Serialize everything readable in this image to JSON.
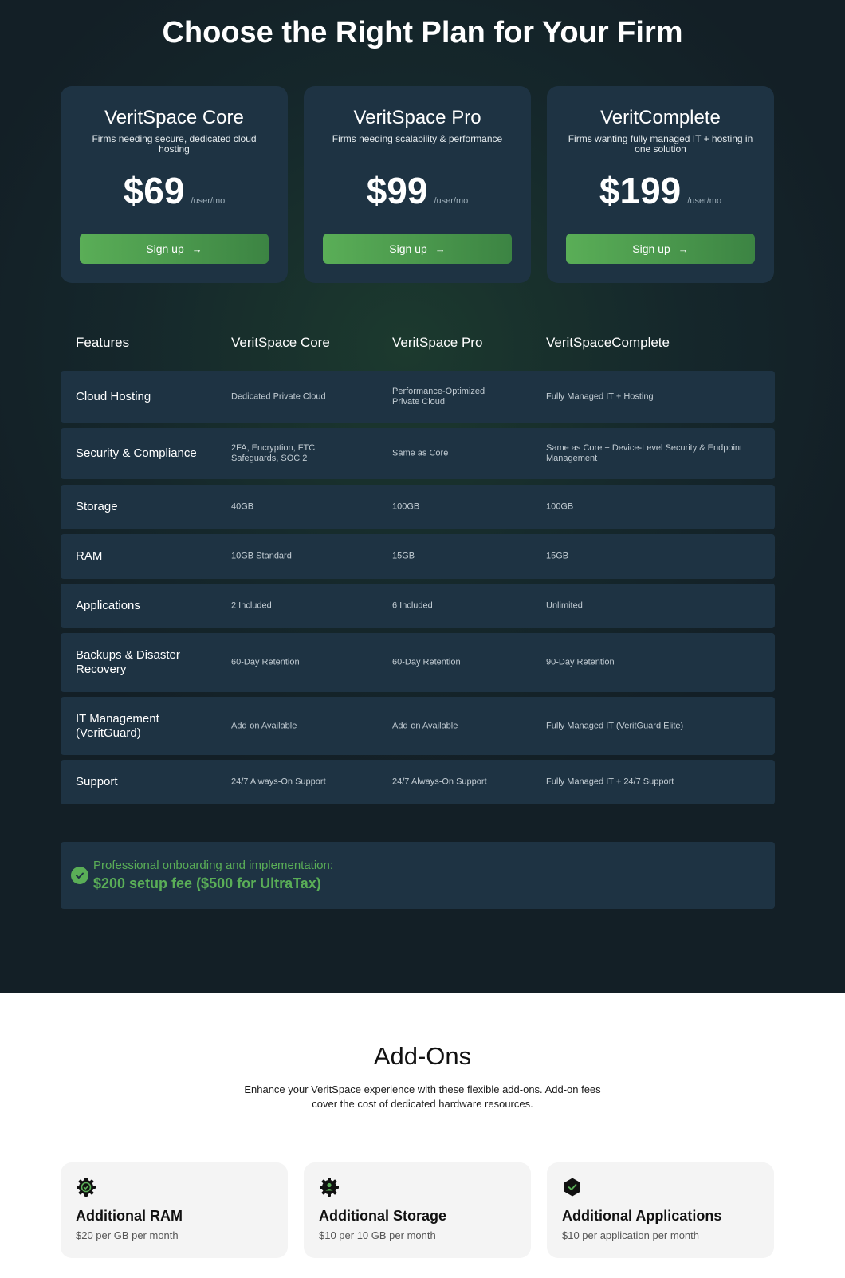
{
  "header": {
    "title": "Choose the Right Plan for Your Firm"
  },
  "plans": [
    {
      "name": "VeritSpace Core",
      "description": "Firms needing secure, dedicated cloud hosting",
      "price": "$69",
      "unit": "/user/mo",
      "cta": "Sign up"
    },
    {
      "name": "VeritSpace Pro",
      "description": "Firms needing scalability & performance",
      "price": "$99",
      "unit": "/user/mo",
      "cta": "Sign up"
    },
    {
      "name": "VeritComplete",
      "description": "Firms wanting fully managed IT + hosting in one solution",
      "price": "$199",
      "unit": "/user/mo",
      "cta": "Sign up"
    }
  ],
  "table": {
    "headers": [
      "Features",
      "VeritSpace Core",
      "VeritSpace Pro",
      "VeritSpaceComplete"
    ],
    "rows": [
      {
        "feature": "Cloud Hosting",
        "core": "Dedicated Private Cloud",
        "pro": "Performance-Optimized Private Cloud",
        "complete": "Fully Managed IT + Hosting"
      },
      {
        "feature": "Security & Compliance",
        "core": "2FA, Encryption, FTC Safeguards, SOC 2",
        "pro": "Same as Core",
        "complete": "Same as Core + Device-Level Security & Endpoint Management"
      },
      {
        "feature": "Storage",
        "core": "40GB",
        "pro": "100GB",
        "complete": "100GB"
      },
      {
        "feature": "RAM",
        "core": "10GB Standard",
        "pro": "15GB",
        "complete": "15GB"
      },
      {
        "feature": "Applications",
        "core": "2 Included",
        "pro": "6 Included",
        "complete": "Unlimited"
      },
      {
        "feature": "Backups & Disaster Recovery",
        "core": "60-Day Retention",
        "pro": "60-Day Retention",
        "complete": "90-Day Retention"
      },
      {
        "feature": "IT Management (VeritGuard)",
        "core": "Add-on Available",
        "pro": "Add-on Available",
        "complete": "Fully Managed IT (VeritGuard Elite)"
      },
      {
        "feature": "Support",
        "core": "24/7 Always-On Support",
        "pro": "24/7 Always-On Support",
        "complete": "Fully Managed IT + 24/7 Support"
      }
    ]
  },
  "onboarding": {
    "text": "Professional onboarding and implementation:",
    "fee": "$200 setup fee ($500 for UltraTax)"
  },
  "addons": {
    "title": "Add-Ons",
    "subtitle": "Enhance your VeritSpace experience with these flexible add-ons. Add-on fees cover the cost of dedicated hardware resources.",
    "items": [
      {
        "name": "Additional RAM",
        "price": "$20 per GB per month",
        "icon": "gear-check-icon"
      },
      {
        "name": "Additional Storage",
        "price": "$10 per 10 GB per month",
        "icon": "gear-user-icon"
      },
      {
        "name": "Additional Applications",
        "price": "$10 per application per month",
        "icon": "hexagon-check-icon"
      }
    ]
  },
  "colors": {
    "accent": "#5aae57",
    "card": "#1e3343",
    "background": "#15272b"
  }
}
